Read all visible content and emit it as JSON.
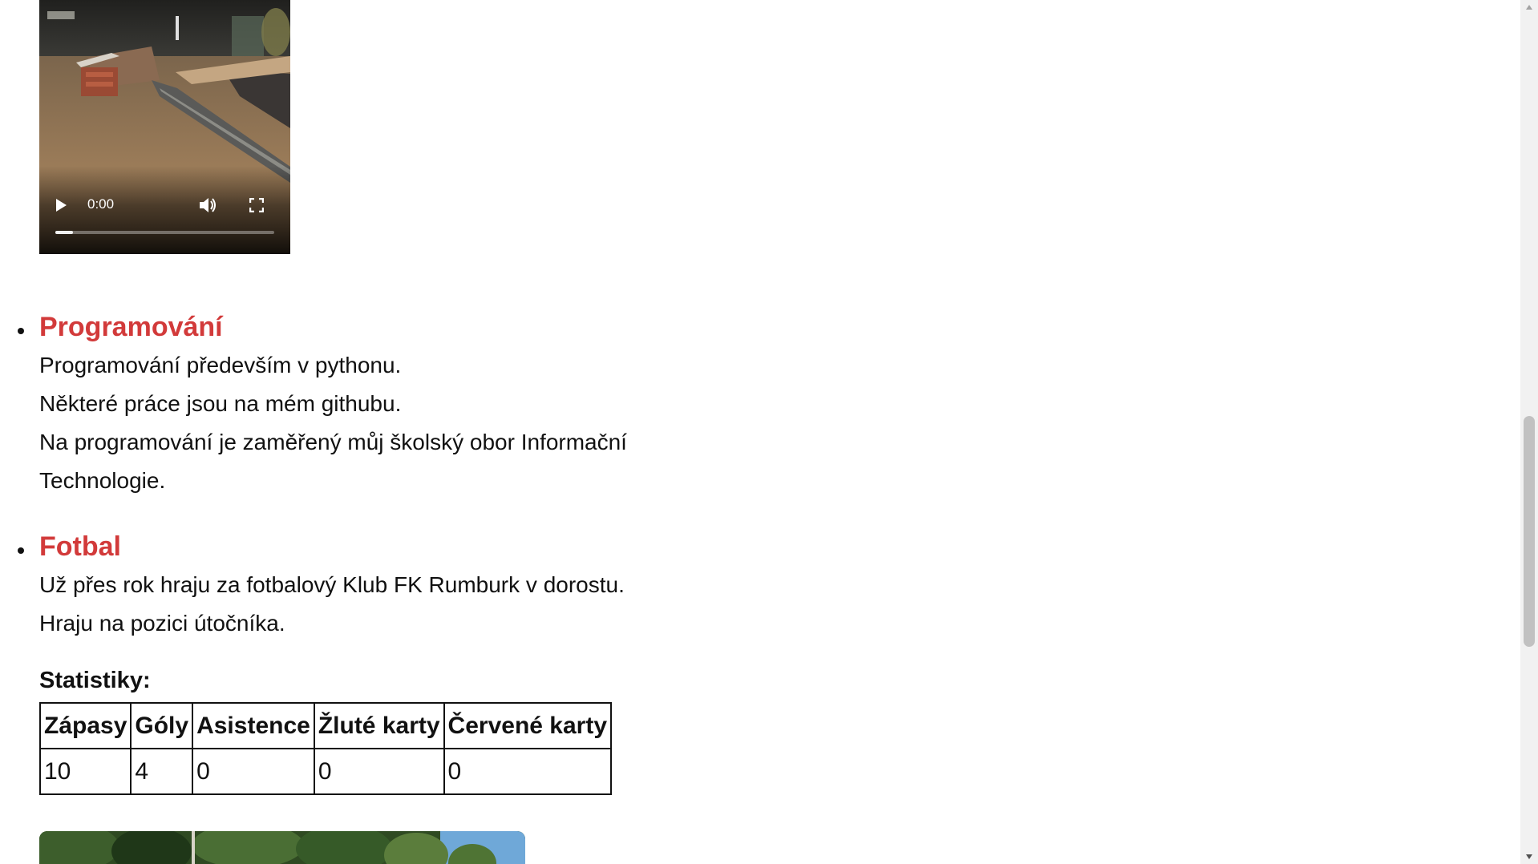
{
  "video": {
    "current_time": "0:00",
    "progress_fraction": 0.0,
    "icons": [
      "play-icon",
      "volume-icon",
      "fullscreen-icon",
      "more-options-icon"
    ]
  },
  "sections": [
    {
      "title": "Programování",
      "lines": [
        "Programování především v pythonu.",
        "Některé práce jsou na mém githubu.",
        "Na programování je zaměřený můj školský obor Informační",
        "Technologie."
      ]
    },
    {
      "title": "Fotbal",
      "lines": [
        "Už přes rok hraju za fotbalový Klub FK Rumburk v dorostu.",
        "Hraju na pozici útočníka."
      ],
      "stats_heading": "Statistiky:",
      "stats_table": {
        "headers": [
          "Zápasy",
          "Góly",
          "Asistence",
          "Žluté karty",
          "Červené karty"
        ],
        "rows": [
          [
            "10",
            "4",
            "0",
            "0",
            "0"
          ]
        ]
      }
    }
  ],
  "colors": {
    "heading": "#d23a3a",
    "text": "#111111",
    "background": "#ffffff"
  }
}
